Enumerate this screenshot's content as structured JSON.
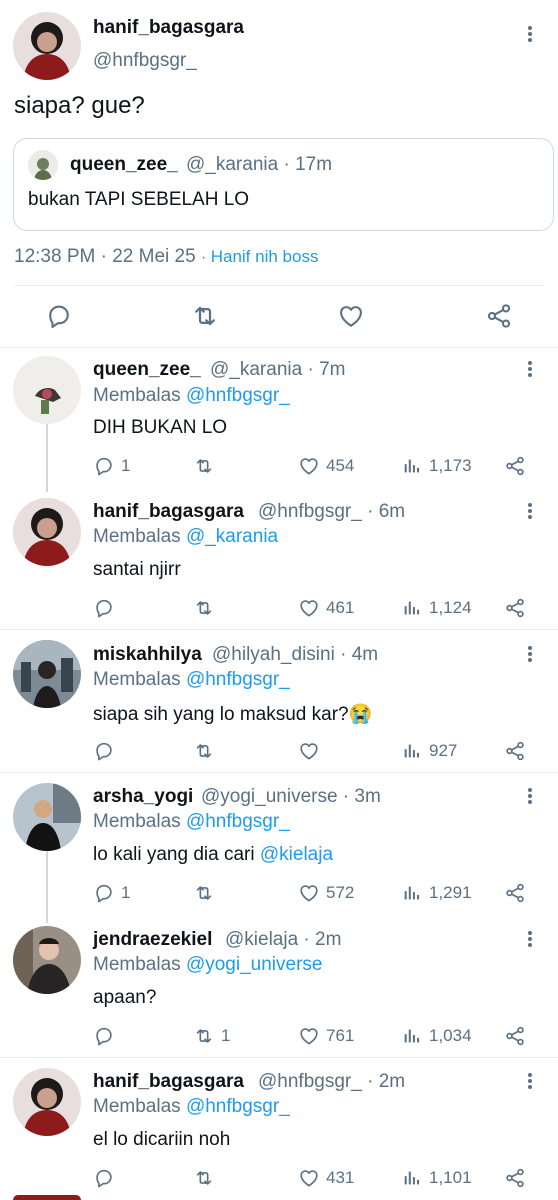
{
  "main_tweet": {
    "display_name": "hanif_bagasgara",
    "handle": "@hnfbgsgr_",
    "text": "siapa? gue?",
    "quote": {
      "display_name": "queen_zee_",
      "handle": "@_karania",
      "time": "17m",
      "text": "bukan TAPI SEBELAH LO"
    },
    "timestamp": "12:38 PM · 22 Mei 25",
    "source": "Hanif nih boss",
    "actions": [
      "reply-icon",
      "retweet-icon",
      "like-icon",
      "share-icon"
    ]
  },
  "replies": [
    {
      "display_name": "queen_zee_",
      "handle": "@_karania",
      "time": "7m",
      "replying_prefix": "Membalas",
      "replying_to": "@hnfbgsgr_",
      "text": "DIH BUKAN LO",
      "reply_count": "1",
      "retweet_count": "",
      "like_count": "454",
      "view_count": "1,173"
    },
    {
      "display_name": "hanif_bagasgara",
      "handle": "@hnfbgsgr_",
      "time": "6m",
      "replying_prefix": "Membalas",
      "replying_to": "@_karania",
      "text": "santai njirr",
      "reply_count": "",
      "retweet_count": "",
      "like_count": "461",
      "view_count": "1,124"
    },
    {
      "display_name": "miskahhilya",
      "handle": "@hilyah_disini",
      "time": "4m",
      "replying_prefix": "Membalas",
      "replying_to": "@hnfbgsgr_",
      "text": "siapa sih yang lo maksud kar?😭",
      "reply_count": "",
      "retweet_count": "",
      "like_count": "",
      "view_count": "927"
    },
    {
      "display_name": "arsha_yogi",
      "handle": "@yogi_universe",
      "time": "3m",
      "replying_prefix": "Membalas",
      "replying_to": "@hnfbgsgr_",
      "text": "lo kali yang dia cari",
      "mention": "@kielaja",
      "reply_count": "1",
      "retweet_count": "",
      "like_count": "572",
      "view_count": "1,291"
    },
    {
      "display_name": "jendraezekiel",
      "handle": "@kielaja",
      "time": "2m",
      "replying_prefix": "Membalas",
      "replying_to": "@yogi_universe",
      "text": "apaan?",
      "reply_count": "",
      "retweet_count": "1",
      "like_count": "761",
      "view_count": "1,034"
    },
    {
      "display_name": "hanif_bagasgara",
      "handle": "@hnfbgsgr_",
      "time": "2m",
      "replying_prefix": "Membalas",
      "replying_to": "@hnfbgsgr_",
      "text": "el lo dicariin noh",
      "reply_count": "",
      "retweet_count": "",
      "like_count": "431",
      "view_count": "1,101"
    }
  ],
  "colors": {
    "accent": "#1d9bf0",
    "text": "#0f1419",
    "secondary": "#5b7083",
    "divider": "#e6ecf0"
  }
}
